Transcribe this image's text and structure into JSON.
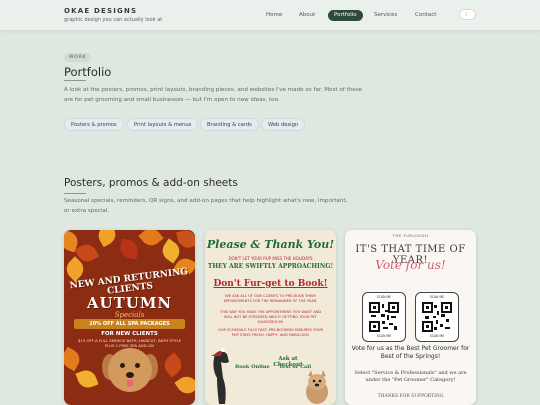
{
  "brand": {
    "name": "OKAE DESIGNS",
    "tagline": "graphic design you can actually look at"
  },
  "nav": {
    "items": [
      "Home",
      "About",
      "Portfolio",
      "Services",
      "Contact"
    ],
    "active": "Portfolio",
    "theme_icon": "moon-icon"
  },
  "intro": {
    "eyebrow": "WORK",
    "title": "Portfolio",
    "text": "A look at the posters, promos, print layouts, branding pieces, and websites I've made so far. Most of these are for pet grooming and small businesses — but I'm open to new ideas, too."
  },
  "filters": [
    "Posters & promos",
    "Print layouts & menus",
    "Branding & cards",
    "Web design"
  ],
  "section": {
    "title": "Posters, promos & add-on sheets",
    "text": "Seasonal specials, reminders, QR signs, and add-on pages that help highlight what's new, important, or extra special."
  },
  "cards": {
    "autumn": {
      "headline": "NEW AND RETURNING CLIENTS",
      "title": "AUTUMN",
      "subtitle": "Specials",
      "banner": "20% OFF ALL SPA PACKAGES",
      "new_clients": "FOR NEW CLIENTS",
      "fine": "$15 OFF A FULL SERVICE BATH, HAIRCUT, BATH STYLE PLUS 1 FREE SPA ADD-ON"
    },
    "thanks": {
      "title": "Please & Thank You!",
      "top_line": "DON'T LET YOUR PUP MISS THE HOLIDAYS",
      "swiftly": "THEY ARE SWIFTLY APPROACHING!",
      "book": "Don't Fur-get to Book!",
      "body1": "WE ASK ALL OF OUR CLIENTS TO PRE-BOOK THEIR APPOINTMENTS FOR THE REMAINDER OF THE YEAR.",
      "body2": "THIS WAY YOU HAVE THE APPOINTMENT YOU WANT AND WILL NOT BE STRESSED ABOUT GETTING YOUR PET SQUEEZED IN!",
      "body3": "OUR SCHEDULE FILLS FAST. PRE-BOOKING ENSURES YOUR PUP STAYS FRESH, HAPPY, AND FABULOUS!",
      "ask": "Ask at Checkout",
      "opt1": "Book Online",
      "opt2": "Text or Call"
    },
    "vote": {
      "brand": "THE FURLOUGH",
      "headline": "IT'S THAT TIME OF YEAR!",
      "script": "Vote for us!",
      "scan": "SCAN ME",
      "desc": "Vote for us as the Best Pet Groomer for Best of the Springs!",
      "small": "Select \"Service & Professionals\" and we are under the \"Pet Groomer\" Category!",
      "thanks": "THANKS FOR SUPPORTING"
    }
  }
}
